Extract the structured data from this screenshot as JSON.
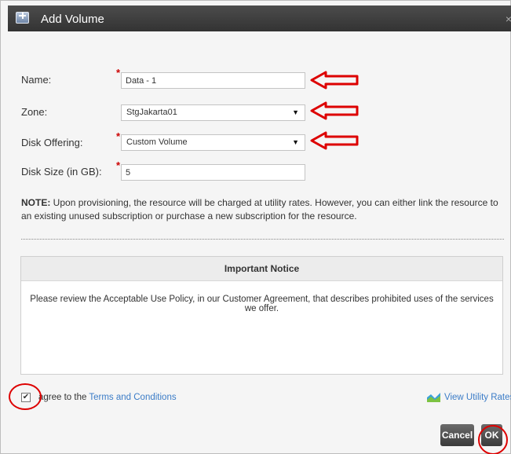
{
  "dialog": {
    "title": "Add Volume",
    "close_glyph": "×",
    "title_icon": "add-volume-icon"
  },
  "form": {
    "name": {
      "label": "Name:",
      "value": "Data - 1",
      "required_mark": "*"
    },
    "zone": {
      "label": "Zone:",
      "value": "StgJakarta01"
    },
    "disk_offering": {
      "label": "Disk Offering:",
      "value": "Custom Volume",
      "required_mark": "*"
    },
    "disk_size": {
      "label": "Disk Size (in GB):",
      "value": "5",
      "required_mark": "*"
    }
  },
  "note": {
    "prefix": "NOTE:",
    "text": " Upon provisioning, the resource will be charged at utility rates.  However, you can either link the resource to an existing unused subscription or purchase a new subscription for the resource."
  },
  "notice": {
    "title": "Important Notice",
    "body": "Please review the Acceptable Use Policy, in our Customer Agreement, that describes prohibited uses of the services we offer."
  },
  "footer": {
    "agree_checked": true,
    "agree_text": "agree to the ",
    "terms_link": "Terms and Conditions",
    "rates_link": "View Utility Rates",
    "cancel_label": "Cancel",
    "ok_label": "OK"
  },
  "colors": {
    "accent_red": "#dd0000",
    "link_blue": "#3b7cc7",
    "titlebar": "#3a3a3a"
  }
}
